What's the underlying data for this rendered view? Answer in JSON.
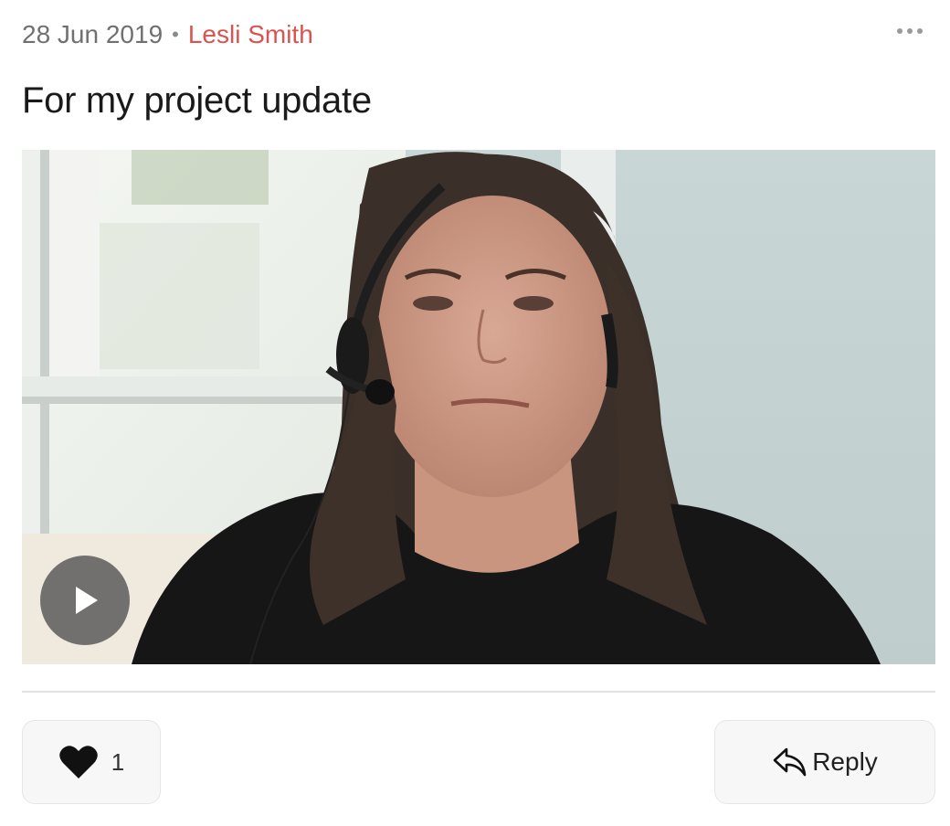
{
  "post": {
    "date": "28 Jun 2019",
    "separator": "•",
    "author": "Lesli Smith",
    "title": "For my project update",
    "more_icon": "ellipsis-icon"
  },
  "video": {
    "play_icon": "play-icon"
  },
  "actions": {
    "like_icon": "heart-icon",
    "like_count": "1",
    "reply_icon": "reply-arrow-icon",
    "reply_label": "Reply"
  },
  "colors": {
    "author": "#d9534f",
    "date": "#707070",
    "button_bg": "#f7f7f7"
  }
}
